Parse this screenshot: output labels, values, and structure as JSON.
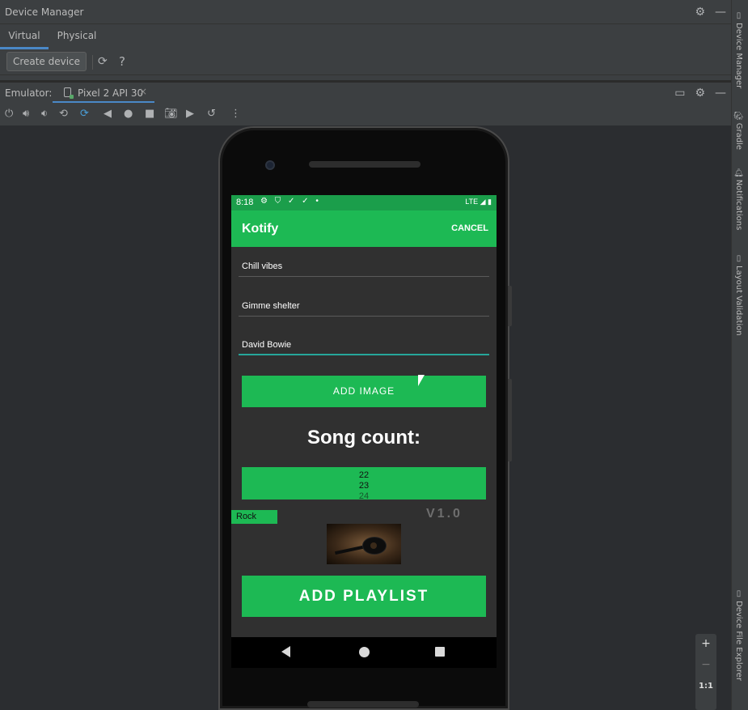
{
  "device_manager": {
    "title": "Device Manager",
    "tabs": [
      "Virtual",
      "Physical"
    ],
    "create_button": "Create device",
    "help": "?"
  },
  "emulator": {
    "label": "Emulator:",
    "tab_name": "Pixel 2 API 30",
    "tab_close": "×"
  },
  "right_sidebar": {
    "tabs": [
      "Device Manager",
      "Gradle",
      "Notifications",
      "Layout Validation",
      "Device File Explorer"
    ]
  },
  "phone": {
    "status_bar": {
      "time": "8:18",
      "icons": "⚙ ⛉ ✓ ✓ •",
      "right": "LTE ◢ ▮"
    },
    "app_bar": {
      "title": "Kotify",
      "action": "CANCEL"
    },
    "fields": [
      {
        "value": "Chill vibes"
      },
      {
        "value": "Gimme shelter"
      },
      {
        "value": "David Bowie"
      }
    ],
    "add_image_button": "ADD IMAGE",
    "song_count_label": "Song count:",
    "song_picker": [
      "22",
      "23",
      "24"
    ],
    "genre": "Rock",
    "version": "V1.0",
    "add_playlist_button": "ADD PLAYLIST"
  },
  "zoom_controls": {
    "zoom_in": "+",
    "zoom_out": "−",
    "actual_size": "1:1"
  },
  "colors": {
    "ide_bg": "#2b2b2b",
    "panel_bg": "#3c3f41",
    "accent_blue": "#4a88c7",
    "app_green": "#1db954",
    "status_green": "#1b9e4b",
    "focus_teal": "#26a69a"
  }
}
